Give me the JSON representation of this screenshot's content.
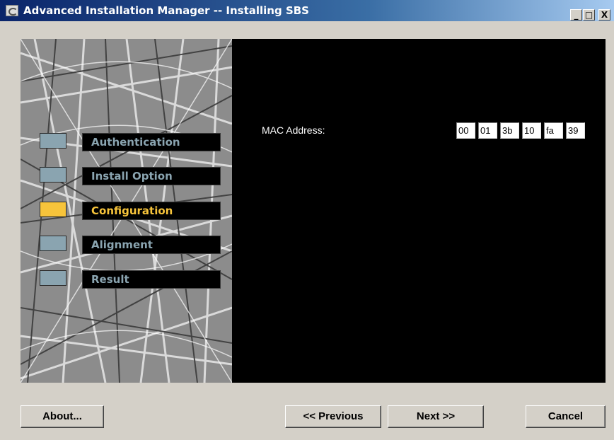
{
  "window": {
    "title": "Advanced Installation Manager -- Installing SBS",
    "controls": {
      "minimize": "_",
      "maximize": "□",
      "close": "X"
    }
  },
  "steps": [
    {
      "label": "Authentication",
      "active": false
    },
    {
      "label": "Install Option",
      "active": false
    },
    {
      "label": "Configuration",
      "active": true
    },
    {
      "label": "Alignment",
      "active": false
    },
    {
      "label": "Result",
      "active": false
    }
  ],
  "colors": {
    "active_step": "#f7c43b",
    "inactive_step": "#8aa4b0",
    "panel_bg": "#000000",
    "window_bg": "#d4d0c8"
  },
  "form": {
    "mac_label": "MAC Address:",
    "mac_octets": [
      "00",
      "01",
      "3b",
      "10",
      "fa",
      "39"
    ]
  },
  "buttons": {
    "about": "About...",
    "previous": "<< Previous",
    "next": "Next >>",
    "cancel": "Cancel"
  }
}
